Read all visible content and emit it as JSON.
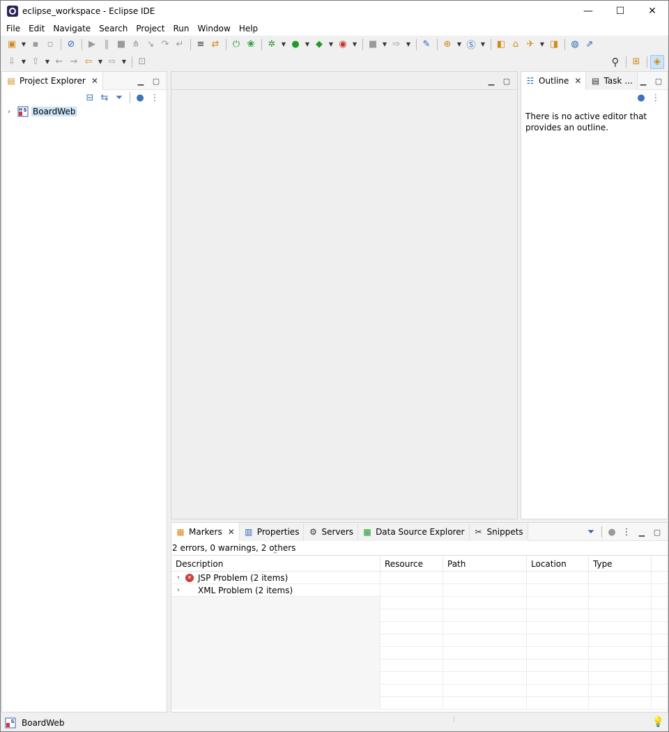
{
  "window": {
    "title": "eclipse_workspace - Eclipse IDE",
    "controls": {
      "minimize": "—",
      "maximize": "☐",
      "close": "✕"
    }
  },
  "menu": [
    "File",
    "Edit",
    "Navigate",
    "Search",
    "Project",
    "Run",
    "Window",
    "Help"
  ],
  "toolbar": {
    "row1_icons": [
      "new-icon",
      "save-icon",
      "save-all-icon",
      "skip-breakpoints-icon",
      "resume-icon",
      "suspend-icon",
      "terminate-icon",
      "disconnect-icon",
      "step-into-icon",
      "step-over-icon",
      "step-return-icon",
      "use-step-filters-icon",
      "toggle-breakpoint-icon",
      "spring-boot-icon",
      "spring-icon",
      "debug-icon",
      "run-icon",
      "coverage-icon",
      "external-tools-icon",
      "stop-server-icon",
      "new-java-class-icon",
      "new-package-icon",
      "new-web-icon",
      "new-service-icon",
      "open-type-icon",
      "open-task-icon",
      "open-file-icon",
      "open-folder-icon"
    ],
    "row2_icons": [
      "annotation-icon",
      "back-icon",
      "forward-icon",
      "pin-editor-icon",
      "search-icon",
      "open-perspective-icon",
      "java-ee-perspective-icon"
    ]
  },
  "project_explorer": {
    "tab_label": "Project Explorer",
    "items": [
      {
        "label": "BoardWeb",
        "expanded": false
      }
    ]
  },
  "outline": {
    "tab_label": "Outline",
    "second_tab_label": "Task ...",
    "message": "There is no active editor that provides an outline."
  },
  "bottom_panel": {
    "tabs": [
      "Markers",
      "Properties",
      "Servers",
      "Data Source Explorer",
      "Snippets"
    ],
    "summary": "2 errors, 0 warnings, 2 others",
    "columns": [
      "Description",
      "Resource",
      "Path",
      "Location",
      "Type"
    ],
    "rows": [
      {
        "description": "JSP Problem (2 items)",
        "severity": "error"
      },
      {
        "description": "XML Problem (2 items)",
        "severity": "other"
      }
    ]
  },
  "status_bar": {
    "selection": "BoardWeb"
  },
  "colors": {
    "selection": "#cce4f7",
    "error": "#d03a3a",
    "panel_bg": "#ffffff",
    "chrome_bg": "#f0f0f0"
  }
}
